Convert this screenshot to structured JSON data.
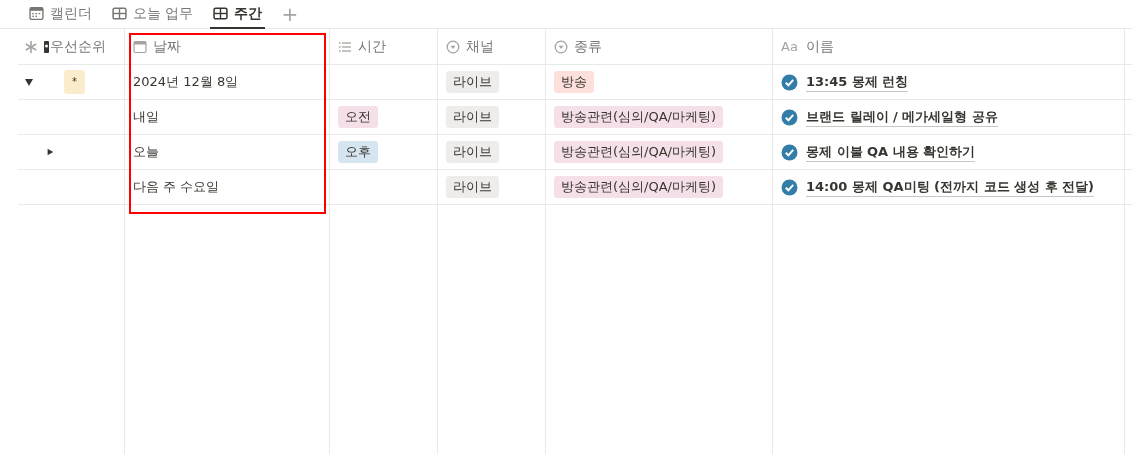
{
  "tabs": [
    {
      "label": "캘린더",
      "selected": false
    },
    {
      "label": "오늘 업무",
      "selected": false
    },
    {
      "label": "주간",
      "selected": true
    }
  ],
  "add_tab": "+",
  "columns": [
    {
      "label": "우선순위"
    },
    {
      "label": "날짜",
      "highlighted": true
    },
    {
      "label": "시간"
    },
    {
      "label": "채널"
    },
    {
      "label": "종류"
    },
    {
      "label": "이름",
      "type_label": "Aa"
    }
  ],
  "rows": [
    {
      "expanded": true,
      "priority": {
        "label": "*",
        "color": "#fbeccb"
      },
      "date": "2024년 12월 8일",
      "channel": {
        "label": "라이브",
        "color": "#eeedeb"
      },
      "type": {
        "label": "방송",
        "color": "#fde0dc"
      },
      "name": "13:45 몽제 런칭",
      "done": true
    },
    {
      "date": "내일",
      "time": {
        "label": "오전",
        "color": "#f5e0e9"
      },
      "channel": {
        "label": "라이브",
        "color": "#eeedeb"
      },
      "type": {
        "label": "방송관련(심의/QA/마케팅)",
        "color": "#f5e0e9"
      },
      "name": "브랜드 릴레이 / 메가세일형 공유",
      "done": true
    },
    {
      "expanded": false,
      "date": "오늘",
      "time": {
        "label": "오후",
        "color": "#d6e6f0"
      },
      "channel": {
        "label": "라이브",
        "color": "#eeedeb"
      },
      "type": {
        "label": "방송관련(심의/QA/마케팅)",
        "color": "#f5e0e9"
      },
      "name": "몽제 이불 QA 내용 확인하기",
      "done": true
    },
    {
      "date": "다음 주 수요일",
      "channel": {
        "label": "라이브",
        "color": "#eeedeb"
      },
      "type": {
        "label": "방송관련(심의/QA/마케팅)",
        "color": "#f5e0e9"
      },
      "name": "14:00 몽제 QA미팅 (전까지 코드 생성 후 전달)",
      "done": true
    }
  ]
}
